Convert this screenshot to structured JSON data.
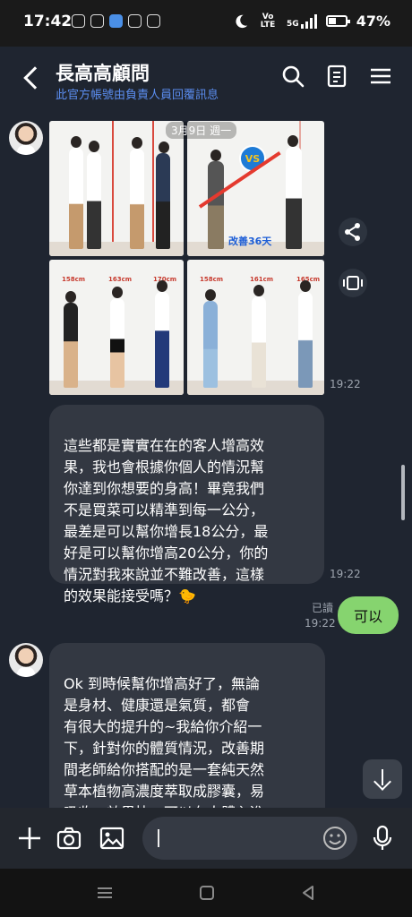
{
  "status_bar": {
    "time": "17:42",
    "network": "Vo LTE",
    "signal": "5G",
    "battery": "47%"
  },
  "header": {
    "title": "長高高顧問",
    "subtitle": "此官方帳號由負責人員回覆訊息"
  },
  "chat": {
    "date_divider": "3月9日 週一",
    "photo_message": {
      "time": "19:22",
      "tags_top_left": [
        "158cm",
        "163cm",
        "170cm"
      ],
      "tags_bottom_right": [
        "158cm",
        "161cm",
        "165cm"
      ],
      "vs_label": "VS",
      "improve_label": "改善36天"
    },
    "text_message": {
      "text": "這些都是實實在在的客人增高效\n果，我也會根據你個人的情況幫\n你達到你想要的身高！畢竟我們\n不是買菜可以精準到每一公分，\n最差是可以幫你增長18公分，最\n好是可以幫你增高20公分，你的\n情況對我來說並不難改善，這樣\n的效果能接受嗎？",
      "emoji": "🐤",
      "time": "19:22"
    },
    "outgoing_message": {
      "text": "可以",
      "read_label": "已讀",
      "time": "19:22"
    },
    "long_message": {
      "text": "Ok 到時候幫你增高好了，無論\n是身材、健康還是氣質，都會\n有很大的提升的~我給你介紹一\n下，針對你的體質情況，改善期\n間老師給你搭配的是一套純天然\n草本植物高濃度萃取成膠囊，易\n吸收、效果快。可以在人體內進\n行針對性的促進生長激素分泌，"
    }
  },
  "input_bar": {
    "placeholder": ""
  },
  "colors": {
    "background": "#1f2530",
    "incoming_bubble": "#333842",
    "outgoing_bubble": "#86d46f",
    "subtitle_blue": "#5b8def"
  }
}
